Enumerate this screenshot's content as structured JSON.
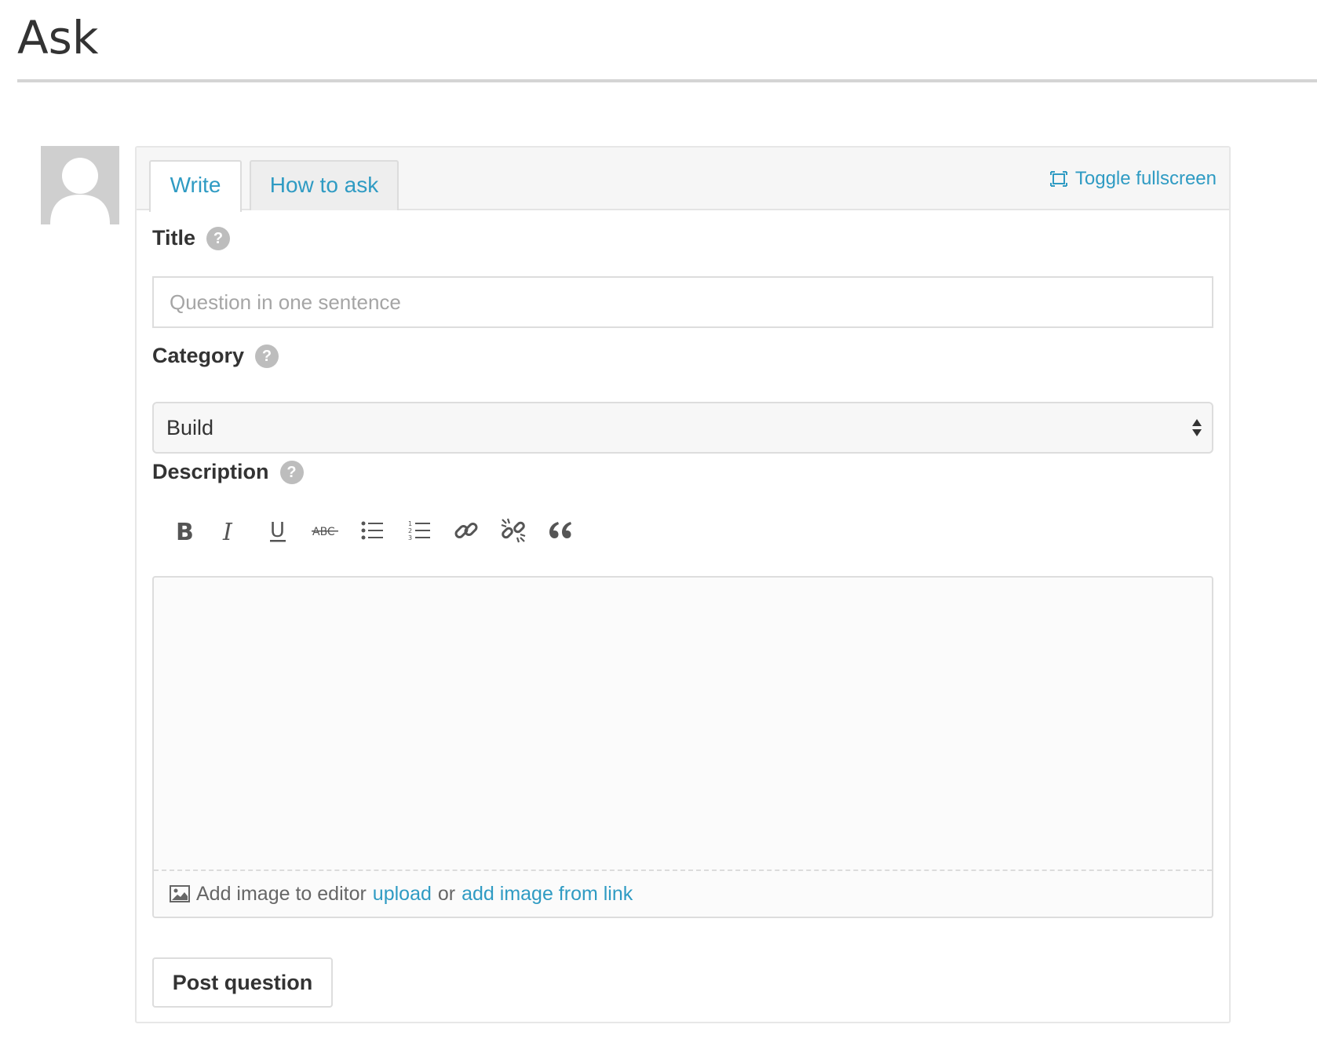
{
  "page": {
    "title": "Ask"
  },
  "tabs": [
    {
      "label": "Write",
      "active": true
    },
    {
      "label": "How to ask",
      "active": false
    }
  ],
  "toggle_fullscreen": {
    "label": "Toggle fullscreen",
    "icon": "fullscreen-icon"
  },
  "form": {
    "title": {
      "label": "Title",
      "placeholder": "Question in one sentence",
      "value": ""
    },
    "category": {
      "label": "Category",
      "value": "Build"
    },
    "description": {
      "label": "Description",
      "value": ""
    }
  },
  "toolbar": [
    {
      "name": "bold-icon",
      "title": "Bold"
    },
    {
      "name": "italic-icon",
      "title": "Italic"
    },
    {
      "name": "underline-icon",
      "title": "Underline"
    },
    {
      "name": "strikethrough-icon",
      "title": "Strikethrough"
    },
    {
      "name": "bulleted-list-icon",
      "title": "Bulleted list"
    },
    {
      "name": "numbered-list-icon",
      "title": "Numbered list"
    },
    {
      "name": "link-icon",
      "title": "Link"
    },
    {
      "name": "unlink-icon",
      "title": "Unlink"
    },
    {
      "name": "quote-icon",
      "title": "Quote"
    }
  ],
  "editor_footer": {
    "prefix": "Add image to editor",
    "upload_link": "upload",
    "middle": "or",
    "from_link": "add image from link"
  },
  "submit": {
    "label": "Post question"
  },
  "colors": {
    "accent": "#2f9bc3",
    "text": "#333333",
    "border": "#dddddd",
    "help_icon": "#bdbdbd"
  }
}
